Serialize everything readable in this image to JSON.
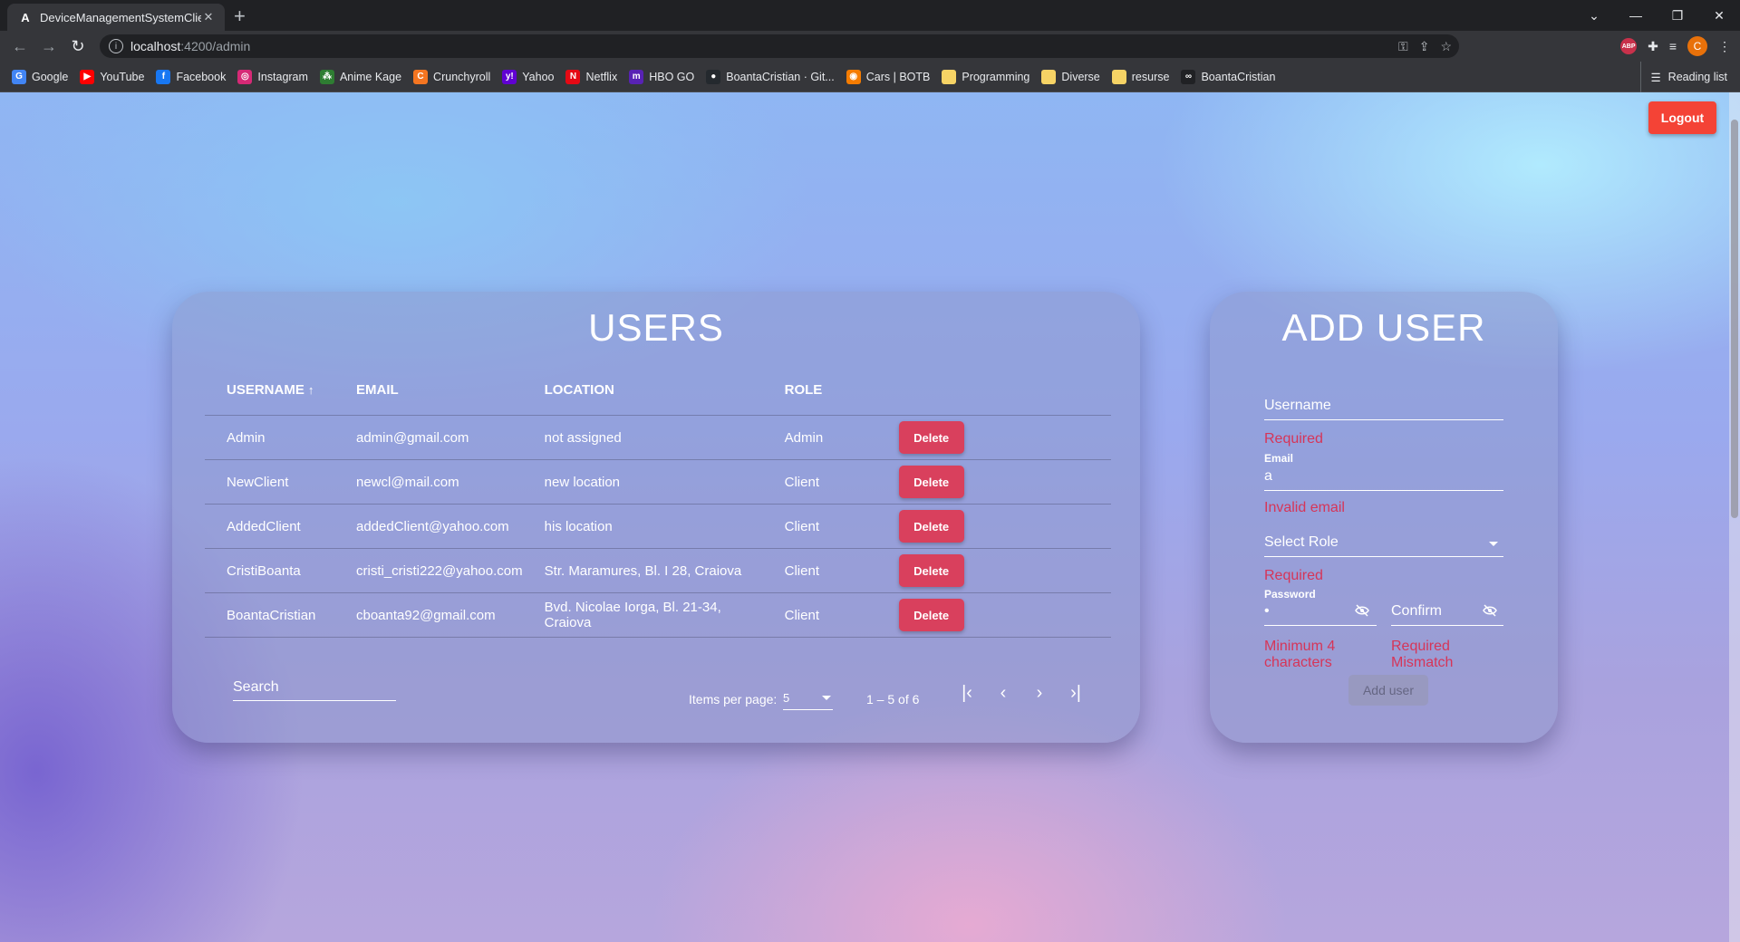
{
  "browser": {
    "tab_title": "DeviceManagementSystemClient",
    "tab_favicon": "A",
    "tab_close": "✕",
    "new_tab": "+",
    "window_controls": [
      "⌄",
      "—",
      "❐",
      "✕"
    ],
    "url_host": "localhost",
    "url_path": ":4200/admin",
    "profile_initial": "C",
    "abp_label": "ABP",
    "bookmarks": [
      {
        "label": "Google",
        "icon": "G",
        "color": "#4285f4"
      },
      {
        "label": "YouTube",
        "icon": "▶",
        "color": "#ff0000"
      },
      {
        "label": "Facebook",
        "icon": "f",
        "color": "#1877f2"
      },
      {
        "label": "Instagram",
        "icon": "◎",
        "color": "#d62976"
      },
      {
        "label": "Anime Kage",
        "icon": "⁂",
        "color": "#2e7d32"
      },
      {
        "label": "Crunchyroll",
        "icon": "C",
        "color": "#f47521"
      },
      {
        "label": "Yahoo",
        "icon": "y!",
        "color": "#6001d2"
      },
      {
        "label": "Netflix",
        "icon": "N",
        "color": "#e50914"
      },
      {
        "label": "HBO GO",
        "icon": "m",
        "color": "#5822b4"
      },
      {
        "label": "BoantaCristian · Git...",
        "icon": "●",
        "color": "#24292e"
      },
      {
        "label": "Cars | BOTB",
        "icon": "◉",
        "color": "#f57c00"
      },
      {
        "label": "Programming",
        "icon": "",
        "color": "#f6d365"
      },
      {
        "label": "Diverse",
        "icon": "",
        "color": "#f6d365"
      },
      {
        "label": "resurse",
        "icon": "",
        "color": "#f6d365"
      },
      {
        "label": "BoantaCristian",
        "icon": "∞",
        "color": "#202124"
      }
    ],
    "reading_list": "Reading list"
  },
  "page": {
    "logout_label": "Logout",
    "users": {
      "title": "USERS",
      "columns": [
        "USERNAME",
        "EMAIL",
        "LOCATION",
        "ROLE"
      ],
      "sort_indicator": "↑",
      "rows": [
        {
          "username": "Admin",
          "email": "admin@gmail.com",
          "location": "not assigned",
          "role": "Admin"
        },
        {
          "username": "NewClient",
          "email": "newcl@mail.com",
          "location": "new location",
          "role": "Client"
        },
        {
          "username": "AddedClient",
          "email": "addedClient@yahoo.com",
          "location": "his location",
          "role": "Client"
        },
        {
          "username": "CristiBoanta",
          "email": "cristi_cristi222@yahoo.com",
          "location": "Str. Maramures, Bl. I 28, Craiova",
          "role": "Client"
        },
        {
          "username": "BoantaCristian",
          "email": "cboanta92@gmail.com",
          "location": "Bvd. Nicolae Iorga, Bl. 21-34, Craiova",
          "role": "Client"
        }
      ],
      "delete_label": "Delete",
      "search_placeholder": "Search",
      "items_per_page_label": "Items per page:",
      "items_per_page_value": "5",
      "range_label": "1 – 5 of 6",
      "pager_icons": [
        "|‹",
        "‹",
        "›",
        "›|"
      ]
    },
    "add_user": {
      "title": "ADD USER",
      "username_label": "Username",
      "username_error": "Required",
      "email_label": "Email",
      "email_value": "a",
      "email_error": "Invalid email",
      "role_label": "Select Role",
      "role_error": "Required",
      "password_label": "Password",
      "password_value": "•",
      "password_error": "Minimum 4 characters",
      "confirm_label": "Confirm",
      "confirm_error_1": "Required",
      "confirm_error_2": "Mismatch",
      "submit_label": "Add user"
    }
  }
}
